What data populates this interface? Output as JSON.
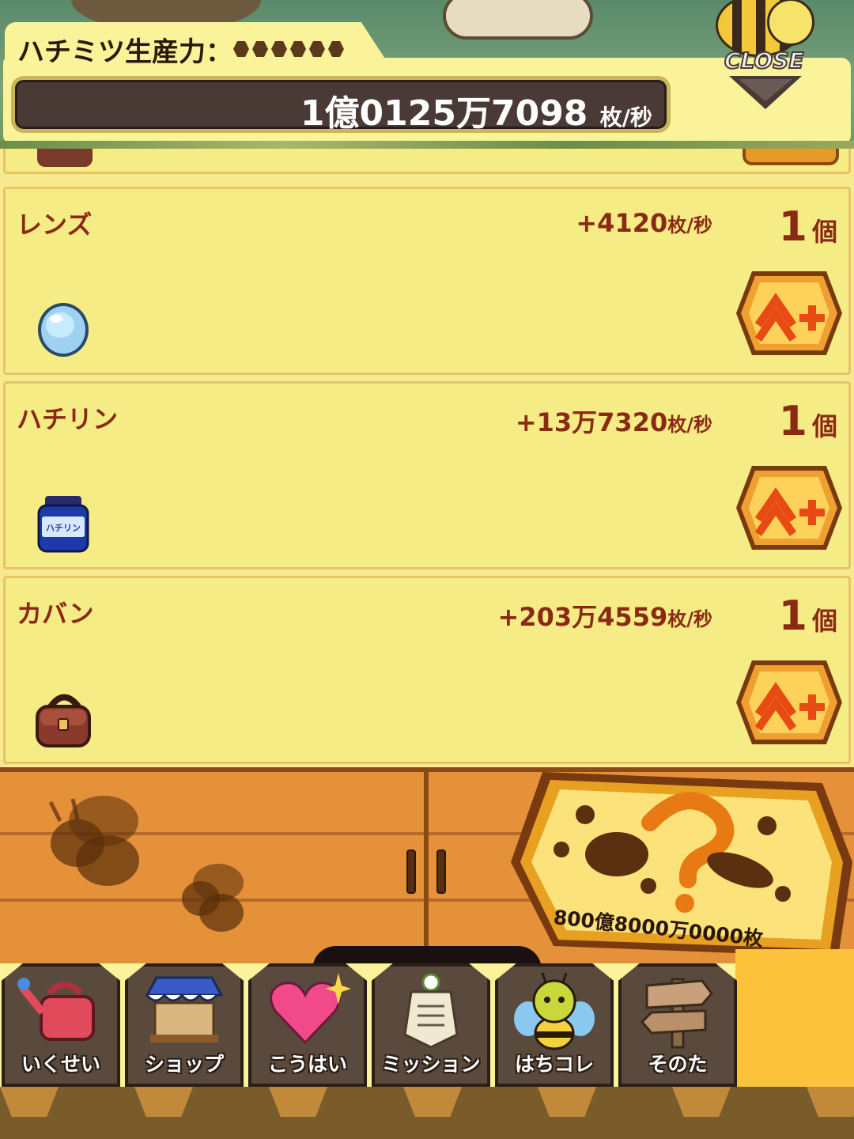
{
  "header": {
    "title": "ハチミツ生産力：",
    "counter_value": "1億0125万7098",
    "counter_unit": "枚/秒",
    "close_label": "CLOSE"
  },
  "items": [
    {
      "name": "レンズ",
      "rate": "+4120",
      "rate_unit": "枚/秒",
      "count": "1",
      "count_unit": "個",
      "icon": "lens-icon"
    },
    {
      "name": "ハチリン",
      "rate": "+13万7320",
      "rate_unit": "枚/秒",
      "count": "1",
      "count_unit": "個",
      "icon": "jar-icon",
      "icon_text": "ハチリン"
    },
    {
      "name": "カバン",
      "rate": "+203万4559",
      "rate_unit": "枚/秒",
      "count": "1",
      "count_unit": "個",
      "icon": "bag-icon"
    }
  ],
  "mystery": {
    "price": "800億8000万0000枚"
  },
  "nav": [
    {
      "label": "いくせい",
      "icon": "watering-can-icon"
    },
    {
      "label": "ショップ",
      "icon": "shop-stall-icon"
    },
    {
      "label": "こうはい",
      "icon": "heart-sparkle-icon"
    },
    {
      "label": "ミッション",
      "icon": "scroll-badge-icon"
    },
    {
      "label": "はちコレ",
      "icon": "bee-icon"
    },
    {
      "label": "そのた",
      "icon": "signpost-icon"
    }
  ],
  "colors": {
    "panel": "#f5ec86",
    "text_accent": "#8a2a14",
    "button_orange": "#e69a2a",
    "nav_tile": "#5a4a3e"
  }
}
